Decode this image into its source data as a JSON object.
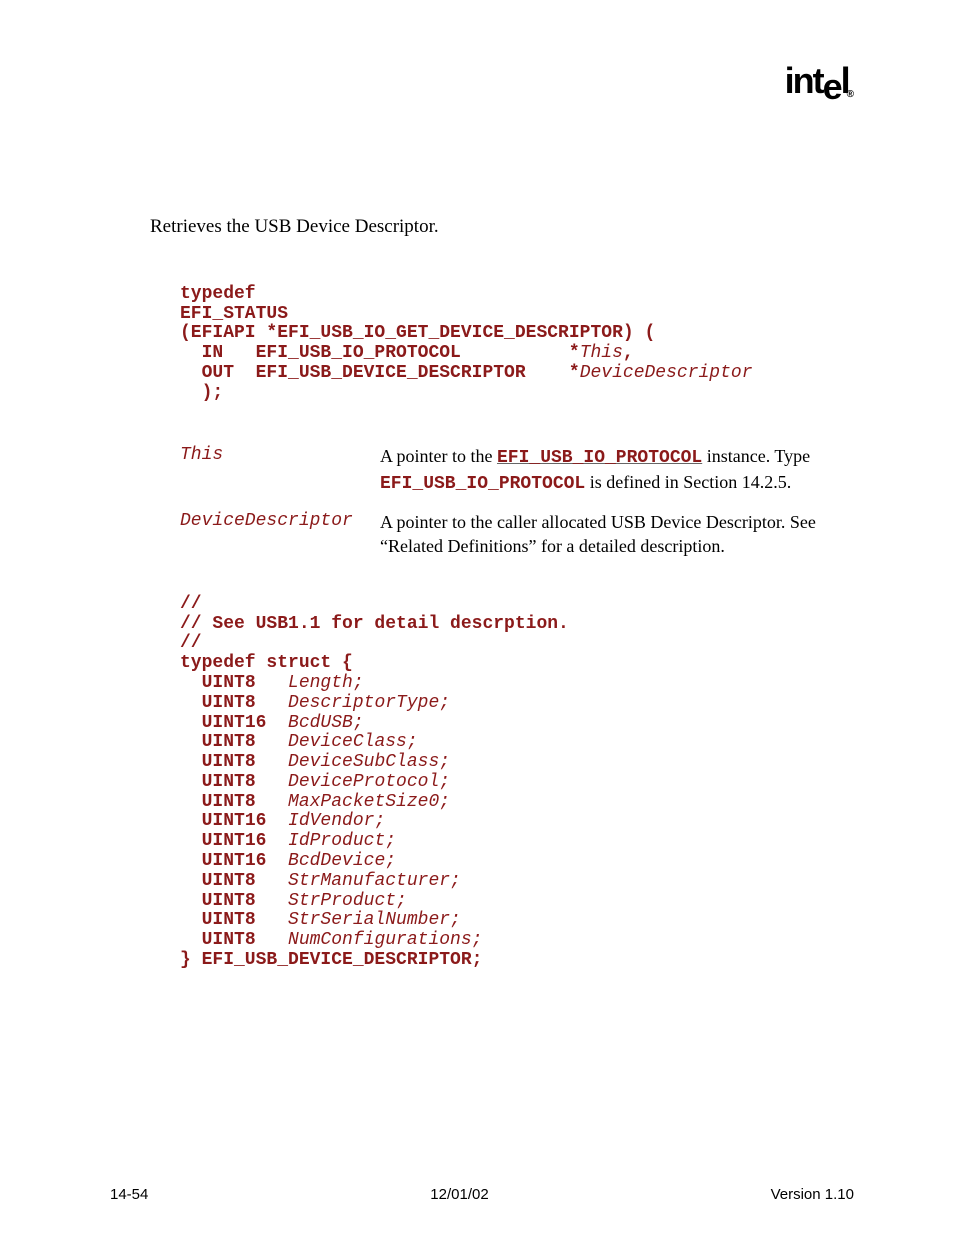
{
  "logo_text": "intel",
  "summary": "Retrieves the USB Device Descriptor.",
  "prototype": {
    "l1": "typedef",
    "l2": "EFI_STATUS",
    "l3a": "(EFIAPI *EFI_USB_IO_GET_DEVICE_DESCRIPTOR) (",
    "l4_kw": "  IN   EFI_USB_IO_PROTOCOL          ",
    "l4_star": "*",
    "l4_it": "This",
    "l4_end": ",",
    "l5_kw": "  OUT  EFI_USB_DEVICE_DESCRIPTOR    ",
    "l5_star": "*",
    "l5_it": "DeviceDescriptor",
    "l6": "  );"
  },
  "params": [
    {
      "name": "This",
      "desc_pre": "A pointer to the ",
      "desc_code1": "EFI_USB_IO_PROTOCOL",
      "desc_mid": " instance.  Type ",
      "desc_code2": "EFI_USB_IO_PROTOCOL",
      "desc_post": " is defined in Section 14.2.5."
    },
    {
      "name": "DeviceDescriptor",
      "desc_full": "A pointer to the caller allocated USB Device Descriptor.  See “Related Definitions” for a detailed description."
    }
  ],
  "struct": {
    "c1": "//",
    "c2": "// See USB1.1 for detail descrption.",
    "c3": "//",
    "head": "typedef struct {",
    "fields": [
      {
        "t": "UINT8",
        "pad": "   ",
        "n": "Length;"
      },
      {
        "t": "UINT8",
        "pad": "   ",
        "n": "DescriptorType;"
      },
      {
        "t": "UINT16",
        "pad": "  ",
        "n": "BcdUSB;"
      },
      {
        "t": "UINT8",
        "pad": "   ",
        "n": "DeviceClass;"
      },
      {
        "t": "UINT8",
        "pad": "   ",
        "n": "DeviceSubClass;"
      },
      {
        "t": "UINT8",
        "pad": "   ",
        "n": "DeviceProtocol;"
      },
      {
        "t": "UINT8",
        "pad": "   ",
        "n": "MaxPacketSize0;"
      },
      {
        "t": "UINT16",
        "pad": "  ",
        "n": "IdVendor;"
      },
      {
        "t": "UINT16",
        "pad": "  ",
        "n": "IdProduct;"
      },
      {
        "t": "UINT16",
        "pad": "  ",
        "n": "BcdDevice;"
      },
      {
        "t": "UINT8",
        "pad": "   ",
        "n": "StrManufacturer;"
      },
      {
        "t": "UINT8",
        "pad": "   ",
        "n": "StrProduct;"
      },
      {
        "t": "UINT8",
        "pad": "   ",
        "n": "StrSerialNumber;"
      },
      {
        "t": "UINT8",
        "pad": "   ",
        "n": "NumConfigurations;"
      }
    ],
    "tail": "} EFI_USB_DEVICE_DESCRIPTOR;"
  },
  "footer": {
    "left": "14-54",
    "center": "12/01/02",
    "right": "Version 1.10"
  }
}
